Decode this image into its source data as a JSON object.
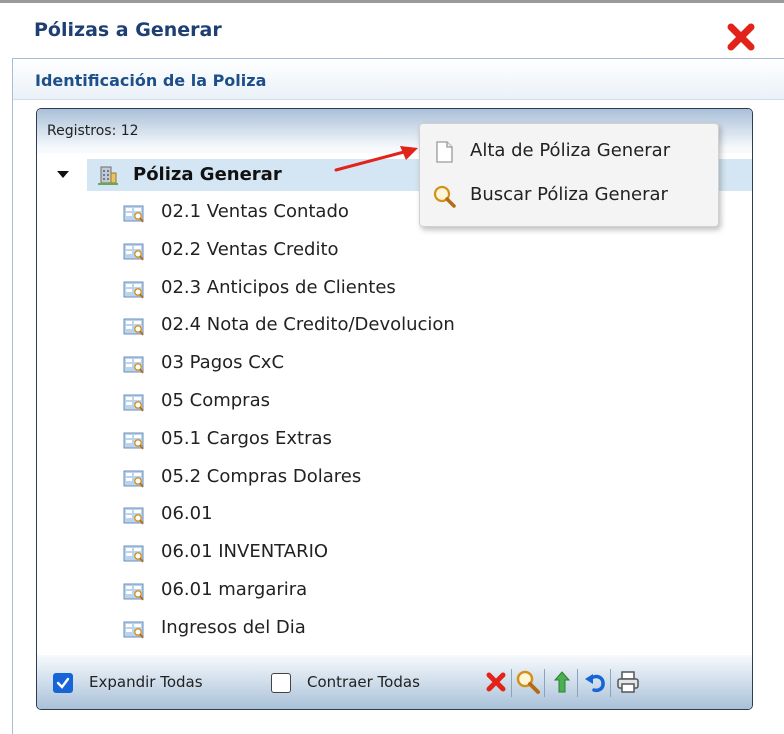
{
  "window": {
    "title": "Pólizas a Generar",
    "close_icon": "close-x-icon",
    "close_color": "#e2231a"
  },
  "panel": {
    "title": "Identificación de la Poliza"
  },
  "tree": {
    "registros": "Registros: 12",
    "root": {
      "label": "Póliza Generar",
      "icon": "building-icon",
      "expanded": true
    },
    "items": [
      {
        "label": "02.1 Ventas Contado"
      },
      {
        "label": "02.2 Ventas Credito"
      },
      {
        "label": "02.3 Anticipos de Clientes"
      },
      {
        "label": "02.4 Nota de Credito/Devolucion"
      },
      {
        "label": "03 Pagos CxC"
      },
      {
        "label": "05 Compras"
      },
      {
        "label": "05.1 Cargos Extras"
      },
      {
        "label": "05.2 Compras Dolares"
      },
      {
        "label": "06.01"
      },
      {
        "label": "06.01 INVENTARIO"
      },
      {
        "label": "06.01 margarira"
      },
      {
        "label": "Ingresos del Dia"
      }
    ]
  },
  "context_menu": {
    "items": [
      {
        "label": "Alta de Póliza Generar",
        "icon": "new-document-icon"
      },
      {
        "label": "Buscar Póliza Generar",
        "icon": "magnifier-icon"
      }
    ]
  },
  "footer": {
    "expand_all": {
      "label": "Expandir Todas",
      "checked": true
    },
    "collapse_all": {
      "label": "Contraer Todas",
      "checked": false
    },
    "tools": [
      "delete-icon",
      "search-icon",
      "move-up-icon",
      "undo-icon",
      "print-icon"
    ]
  },
  "colors": {
    "title": "#1d3f73",
    "accent_check": "#1565d8",
    "selection": "#d4e6f3",
    "annotation_arrow": "#e2231a"
  }
}
